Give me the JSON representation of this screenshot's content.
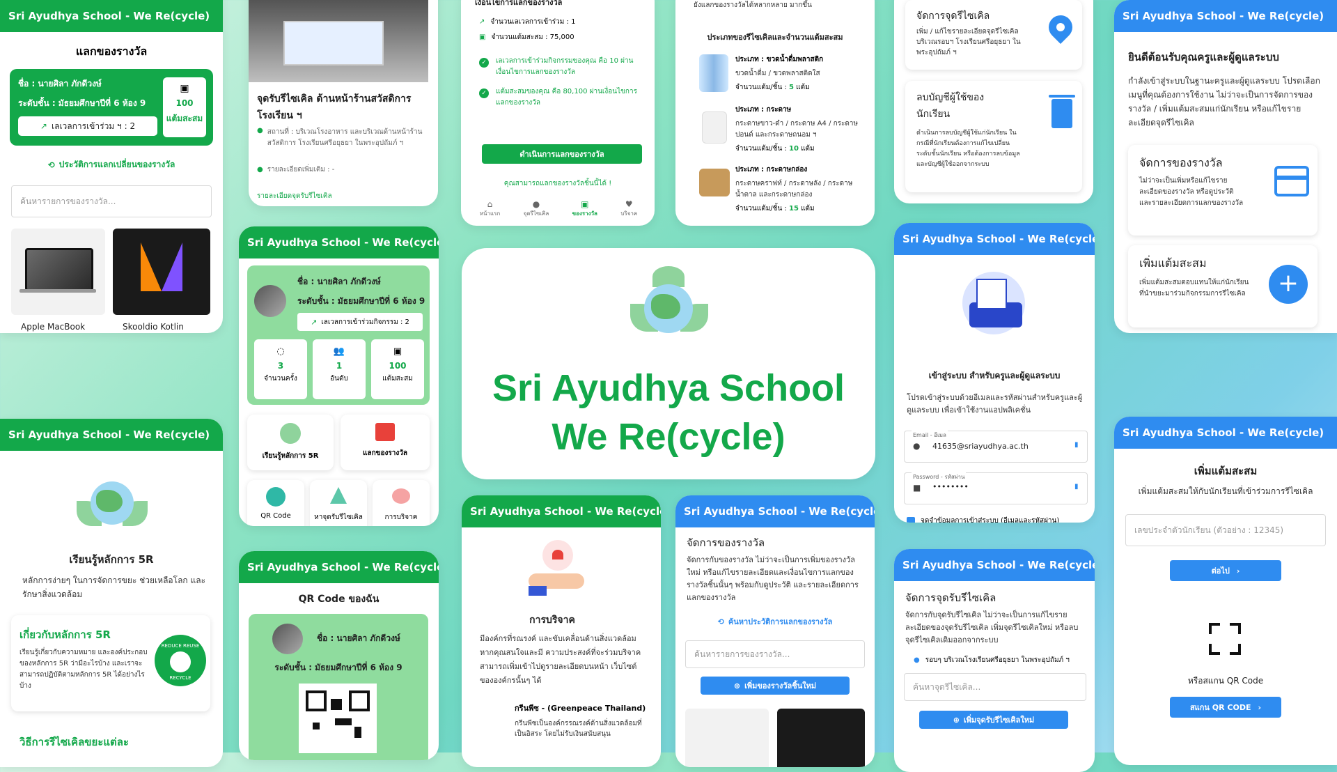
{
  "app_title": "Sri Ayudhya School - We Re(cycle)",
  "hero": {
    "line1": "Sri Ayudhya School",
    "line2": "We Re(cycle)"
  },
  "redeem_card": {
    "title": "แลกของรางวัล",
    "name": "ชื่อ : นายศิลา ภักดีวงษ์",
    "grade": "ระดับชั้น : มัธยมศึกษาปีที่ 6 ห้อง 9",
    "activity": "เลเวลการเข้าร่วม ฯ : 2",
    "points_value": "100",
    "points_label": "แต้มสะสม",
    "history_link": "ประวัติการแลกเปลี่ยนของรางวัล",
    "search_placeholder": "ค้นหารายการของรางวัล...",
    "items": [
      "Apple MacBook",
      "Skooldio Kotlin"
    ]
  },
  "point_card": {
    "title": "จุดรับรีไซเคิล ด้านหน้าร้านสวัสดิการโรงเรียน ฯ",
    "location": "สถานที่ : บริเวณโรงอาหาร และบริเวณด้านหน้าร้านสวัสดิการ โรงเรียนศรีอยุธยา ในพระอุปถัมภ์ ฯ",
    "detail": "รายละเอียดเพิ่มเติม : -",
    "link": "รายละเอียดจุดรับรีไซเคิล"
  },
  "confirm_card": {
    "top_text": "เงื่อนไขการแลกของรางวัล",
    "level": "จำนวนเลเวลการเข้าร่วม : 1",
    "points": "จำนวนแต้มสะสม : 75,000",
    "check1": "เลเวลการเข้าร่วมกิจกรรมของคุณ คือ 10 ผ่านเงื่อนไขการแลกของรางวัล",
    "check2": "แต้มสะสมของคุณ คือ 80,100 ผ่านเงื่อนไขการแลกของรางวัล",
    "button": "ดำเนินการแลกของรางวัล",
    "note": "คุณสามารถแลกของรางวัลชิ้นนี้ได้ !",
    "nav": [
      "หน้าแรก",
      "จุดรีไซเคิล",
      "ของรางวัล",
      "บริจาค"
    ]
  },
  "types_card": {
    "top_text": "ยังแลกของรางวัลได้หลากหลาย มากขึ้น",
    "title": "ประเภทของรีไซเคิลและจำนวนแต้มสะสม",
    "items": [
      {
        "type": "ประเภท : ขวดน้ำดื่มพลาสติก",
        "desc": "ขวดน้ำดื่ม / ขวดพลาสติดใส",
        "points_label": "จำนวนแต้ม/ชิ้น : ",
        "points": "5",
        "unit": " แต้ม"
      },
      {
        "type": "ประเภท : กระดาษ",
        "desc": "กระดาษขาว-ดำ / กระดาษ A4 / กระดาษปอนด์ และกระดาษถนอม ฯ",
        "points_label": "จำนวนแต้ม/ชิ้น : ",
        "points": "10",
        "unit": " แต้ม"
      },
      {
        "type": "ประเภท : กระดาษกล่อง",
        "desc": "กระดาษคราฟท์ / กระดาษลัง / กระดาษน้ำตาล และกระดาษกล่อง",
        "points_label": "จำนวนแต้ม/ชิ้น : ",
        "points": "15",
        "unit": " แต้ม"
      }
    ]
  },
  "admin_top": {
    "manage_points_title": "จัดการจุดรีไซเคิล",
    "manage_points_desc": "เพิ่ม / แก้ไขรายละเอียดจุดรีไซเคิล บริเวณรอบฯ โรงเรียนศรีอยุธยา ในพระอุปถัมภ์ ฯ",
    "delete_title": "ลบบัญชีผู้ใช้ของนักเรียน",
    "delete_desc": "ดำเนินการลบบัญชีผู้ใช้แก่นักเรียน ในกรณีที่นักเรียนต้องการแก้ไขเปลี่ยนระดับชั้นนักเรียน หรือต้องการลบข้อมูลและบัญชีผู้ใช้ออกจากระบบ"
  },
  "welcome_card": {
    "title": "ยินดีต้อนรับคุณครูและผู้ดูแลระบบ",
    "desc": "กำลังเข้าสู่ระบบในฐานะครูและผู้ดูแลระบบ โปรดเลือกเมนูที่คุณต้องการใช้งาน ไม่ว่าจะเป็นการจัดการของรางวัล / เพิ่มแต้มสะสมแก่นักเรียน หรือแก้ไขรายละเอียดจุดรีไซเคิล",
    "reward_title": "จัดการของรางวัล",
    "reward_desc": "ไม่ว่าจะเป็นเพิ่มหรือแก้ไขรายละเอียดของรางวัล หรือดูประวัติและรายละเอียดการแลกของรางวัล",
    "add_title": "เพิ่มแต้มสะสม",
    "add_desc": "เพิ่มแต้มสะสมตอบแทนให้แก่นักเรียนที่นำขยะมาร่วมกิจกรรมการรีไซเคิล"
  },
  "profile_card": {
    "name": "ชื่อ : นายศิลา ภักดีวงษ์",
    "grade": "ระดับชั้น : มัธยมศึกษาปีที่ 6 ห้อง 9",
    "activity": "เลเวลการเข้าร่วมกิจกรรม : 2",
    "stats": [
      {
        "value": "3",
        "label": "จำนวนครั้ง"
      },
      {
        "value": "1",
        "label": "อันดับ"
      },
      {
        "value": "100",
        "label": "แต้มสะสม"
      }
    ],
    "menu": [
      "เรียนรู้หลักการ 5R",
      "แลกของรางวัล"
    ],
    "menu2": [
      "QR Code",
      "หาจุดรับรีไซเคิล",
      "การบริจาค"
    ]
  },
  "login_card": {
    "title": "เข้าสู่ระบบ สำหรับครูและผู้ดูแลระบบ",
    "desc": "โปรดเข้าสู่ระบบด้วยอีเมลและรหัสผ่านสำหรับครูและผู้ดูแลระบบ เพื่อเข้าใช้งานแอปพลิเคชั่น",
    "email_label": "Email - อีเมล",
    "email_value": "41635@sriayudhya.ac.th",
    "password_label": "Password - รหัสผ่าน",
    "password_value": "••••••••",
    "remember": "จดจำข้อมูลการเข้าสู่ระบบ (อีเมลและรหัสผ่าน)"
  },
  "addpoints_card": {
    "title": "เพิ่มแต้มสะสม",
    "desc": "เพิ่มแต้มสะสมให้กับนักเรียนที่เข้าร่วมการรีไซเคิล",
    "placeholder": "เลขประจำตัวนักเรียน (ตัวอย่าง : 12345)",
    "next": "ต่อไป",
    "scan_label": "หรือสแกน QR Code",
    "scan_button": "สแกน QR CODE"
  },
  "learn_card": {
    "title": "เรียนรู้หลักการ 5R",
    "desc": "หลักการง่ายๆ ในการจัดการขยะ ช่วยเหลือโลก และรักษาสิ่งแวดล้อม",
    "about_title": "เกี่ยวกับหลักการ 5R",
    "about_desc": "เรียนรู้เกี่ยวกับความหมาย และองค์ประกอบของหลักการ 5R ว่ามีอะไรบ้าง และเราจะสามารถปฏิบัติตามหลักการ 5R ได้อย่างไรบ้าง",
    "badge_top": "REDUCE REUSE",
    "badge_bottom": "RECYCLE",
    "next_title": "วิธีการรีไซเคิลขยะแต่ละ"
  },
  "qr_card": {
    "title": "QR Code ของฉัน",
    "name": "ชื่อ : นายศิลา ภักดีวงษ์",
    "grade": "ระดับชั้น : มัธยมศึกษาปีที่ 6 ห้อง 9"
  },
  "donate_card": {
    "title": "การบริจาค",
    "desc": "มีองค์กรที่รณรงค์ และขับเคลื่อนด้านสิ่งแวดล้อม หากคุณสนใจและมี ความประสงค์ที่จะร่วมบริจาค สามารถเพิ่มเข้าไปดูรายละเอียดบนหน้า เว็บไซต์ขององค์กรนั้นๆ ได้",
    "org": "กรีนพีซ - (Greenpeace Thailand)",
    "org_desc": "กรีนพีซเป็นองค์กรรณรงค์ด้านสิ่งแวดล้อมที่เป็นอิสระ โดยไม่รับเงินสนับสนุน"
  },
  "manage_reward_card": {
    "title": "จัดการของรางวัล",
    "desc": "จัดการกับของรางวัล ไม่ว่าจะเป็นการเพิ่มของรางวัลใหม่ หรือแก้ไขรายละเอียดและเงื่อนไขการแลกของรางวัลชิ้นนั้นๆ พร้อมกับดูประวัติ และรายละเอียดการแลกของรางวัล",
    "history_link": "ค้นหาประวัติการแลกของรางวัล",
    "search_placeholder": "ค้นหารายการของรางวัล...",
    "add_button": "เพิ่มของรางวัลชิ้นใหม่"
  },
  "manage_points_card": {
    "title": "จัดการจุดรับรีไซเคิล",
    "desc": "จัดการกับจุดรับรีไซเคิล ไม่ว่าจะเป็นการแก้ไขรายละเอียดของจุดรับรีไซเคิล เพิ่มจุดรีไซเคิลใหม่ หรือลบจุดรีไซเคิลเดิมออกจากระบบ",
    "location": "รอบๆ บริเวณโรงเรียนศรีอยุธยา ในพระอุปถัมภ์ ฯ",
    "search_placeholder": "ค้นหาจุดรีไซเคิล...",
    "add_button": "เพิ่มจุดรับรีไซเคิลใหม่"
  },
  "colors": {
    "brand_green": "#13a84a",
    "brand_blue": "#2f8cf0"
  }
}
